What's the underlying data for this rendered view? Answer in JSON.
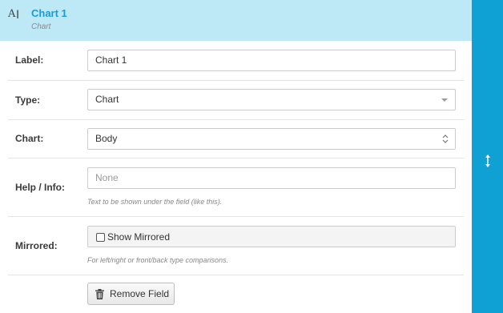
{
  "header": {
    "title": "Chart 1",
    "subtitle": "Chart",
    "icon": "text-field-icon"
  },
  "fields": {
    "label": {
      "label": "Label:",
      "value": "Chart 1"
    },
    "type": {
      "label": "Type:",
      "value": "Chart"
    },
    "chart": {
      "label": "Chart:",
      "value": "Body"
    },
    "help": {
      "label": "Help / Info:",
      "placeholder": "None",
      "hint": "Text to be shown under the field (like this)."
    },
    "mirrored": {
      "label": "Mirrored:",
      "checkbox_label": "Show Mirrored",
      "checked": false,
      "hint": "For left/right or front/back type comparisons."
    }
  },
  "actions": {
    "remove_label": "Remove Field"
  },
  "colors": {
    "header_bg": "#bde9f7",
    "accent": "#1a9bd7",
    "sidebar": "#0fa1d3"
  }
}
